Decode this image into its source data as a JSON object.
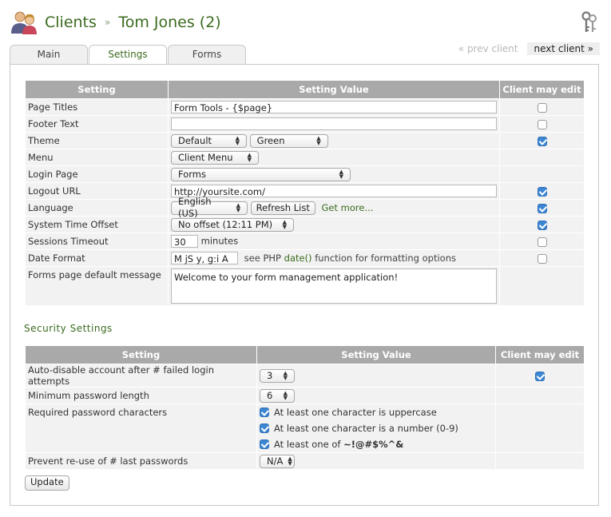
{
  "header": {
    "section": "Clients",
    "separator": "»",
    "client_name": "Tom Jones (2)"
  },
  "tabs": [
    {
      "label": "Main",
      "active": false
    },
    {
      "label": "Settings",
      "active": true
    },
    {
      "label": "Forms",
      "active": false
    }
  ],
  "nav": {
    "prev": "« prev client",
    "next": "next client »"
  },
  "settings": {
    "headers": {
      "setting": "Setting",
      "value": "Setting Value",
      "edit": "Client may edit"
    },
    "page_titles": {
      "label": "Page Titles",
      "value": "Form Tools - {$page}",
      "editable": false
    },
    "footer_text": {
      "label": "Footer Text",
      "value": "",
      "editable": false
    },
    "theme": {
      "label": "Theme",
      "theme_value": "Default",
      "swatch_value": "Green",
      "editable": true
    },
    "menu": {
      "label": "Menu",
      "value": "Client Menu"
    },
    "login_page": {
      "label": "Login Page",
      "value": "Forms"
    },
    "logout_url": {
      "label": "Logout URL",
      "value": "http://yoursite.com/",
      "editable": true
    },
    "language": {
      "label": "Language",
      "value": "English (US)",
      "refresh_label": "Refresh List",
      "get_more": "Get more...",
      "editable": true
    },
    "time_offset": {
      "label": "System Time Offset",
      "value": "No offset (12:11 PM)",
      "editable": true
    },
    "sessions_timeout": {
      "label": "Sessions Timeout",
      "value": "30",
      "unit": "minutes",
      "editable": false
    },
    "date_format": {
      "label": "Date Format",
      "value": "M jS y, g:i A",
      "help_prefix": "see PHP",
      "help_fn": "date()",
      "help_suffix": "function for formatting options",
      "editable": false
    },
    "forms_message": {
      "label": "Forms page default message",
      "value": "Welcome to your form management application!"
    }
  },
  "security": {
    "title": "Security Settings",
    "headers": {
      "setting": "Setting",
      "value": "Setting Value",
      "edit": "Client may edit"
    },
    "auto_disable": {
      "label": "Auto-disable account after # failed login attempts",
      "value": "3",
      "editable": true
    },
    "min_length": {
      "label": "Minimum password length",
      "value": "6"
    },
    "required_chars": {
      "label": "Required password characters",
      "options": [
        {
          "label": "At least one character is uppercase",
          "checked": true
        },
        {
          "label": "At least one character is a number (0-9)",
          "checked": true
        },
        {
          "label_prefix": "At least one of",
          "label_chars": "~!@#$%^&",
          "checked": true
        }
      ]
    },
    "prevent_reuse": {
      "label": "Prevent re-use of # last passwords",
      "value": "N/A"
    }
  },
  "update_button": "Update",
  "colors": {
    "accent": "#3b6b1f",
    "header_bg": "#a9a9a9",
    "row_bg": "#f2f2f2",
    "check_blue": "#3d86d4"
  }
}
